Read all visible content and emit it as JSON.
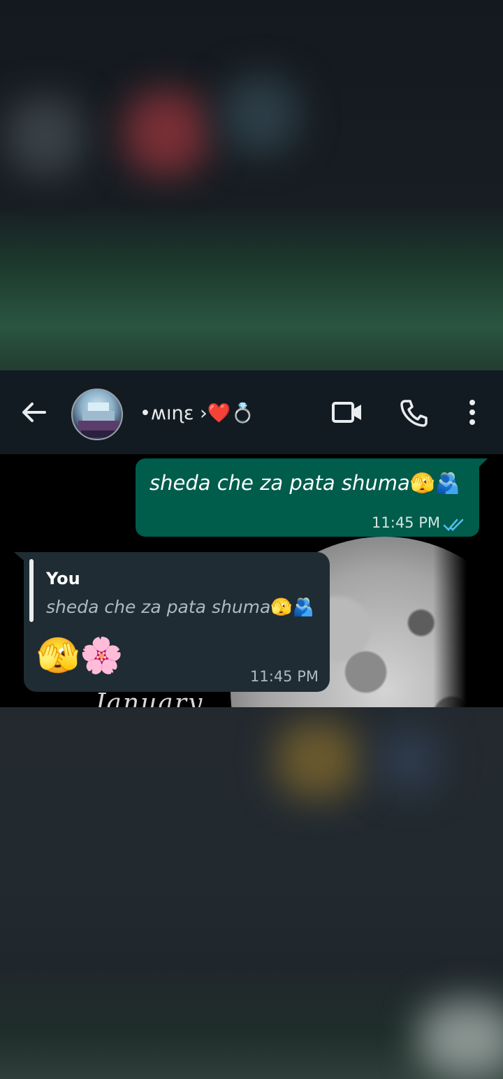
{
  "header": {
    "contact_name": "•ʍıɳɛ ›❤️💍",
    "back_icon": "arrow-left-icon",
    "video_icon": "video-call-icon",
    "call_icon": "phone-icon",
    "menu_icon": "more-vertical-icon"
  },
  "messages": {
    "outgoing": {
      "text": "sheda che za pata shuma",
      "emoji": "🫣🫂",
      "time": "11:45 PM",
      "status_icon": "double-check-icon"
    },
    "incoming": {
      "reply_author": "You",
      "reply_text": "sheda che za pata shuma",
      "reply_emoji": "🫣🫂",
      "body_emoji": "🫣🌸",
      "time": "11:45 PM"
    }
  },
  "wallpaper": {
    "text": "January"
  },
  "colors": {
    "outgoing_bubble": "#005c4b",
    "incoming_bubble": "#1f2c34",
    "header": "#121b22",
    "tick_blue": "#53bdeb"
  }
}
